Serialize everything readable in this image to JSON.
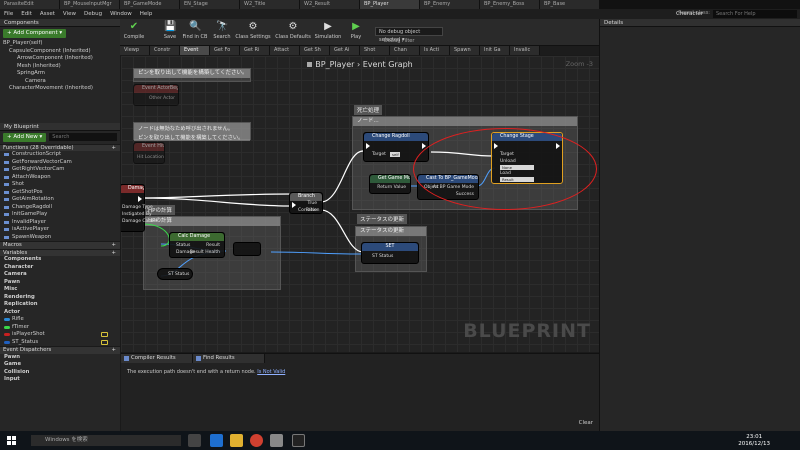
{
  "tabs": [
    "ParasiteEdit",
    "BP_MouseInputMgr",
    "BP_GameMode",
    "EN_Stage",
    "W2_Title",
    "W2_Result",
    "BP_Player",
    "BP_Enemy",
    "BP_Enemy_Boss",
    "BP_Base"
  ],
  "menus": [
    "File",
    "Edit",
    "Asset",
    "View",
    "Debug",
    "Window",
    "Help"
  ],
  "parent_class_label": "Parent class:",
  "parent_class_value": "Character",
  "search_help": "Search For Help",
  "components": {
    "header": "Components",
    "add_label": "+ Add Component ▾",
    "root": "BP_Player(self)",
    "items": [
      "CapsuleComponent (Inherited)",
      "ArrowComponent (Inherited)",
      "Mesh (Inherited)",
      "SpringArm",
      "Camera",
      "CharacterMovement (Inherited)"
    ]
  },
  "my_blueprint": {
    "header": "My Blueprint",
    "add_label": "+ Add New ▾",
    "search_placeholder": "Search",
    "functions_header": "Functions (28 Overridable)",
    "functions": [
      "ConstructionScript",
      "GetForwardVectorCam",
      "GetRightVectorCam",
      "AttachWeapon",
      "Shot",
      "GetShotPos",
      "GetAimRotation",
      "ChangeRagdoll",
      "InitGamePlay",
      "InvalidPlayer",
      "isActivePlayer",
      "SpawnWeapon"
    ],
    "macros_header": "Macros",
    "variables_header": "Variables",
    "var_sections": [
      "Components",
      "Character",
      "Camera",
      "Pawn",
      "Misc",
      "Rendering",
      "Replication",
      "Actor"
    ],
    "variables": [
      {
        "name": "Rifle",
        "color": "#2a8ad8"
      },
      {
        "name": "fTimer",
        "color": "#3ad84a"
      },
      {
        "name": "isPlayerShot",
        "color": "#c82020"
      },
      {
        "name": "ST_Status",
        "color": "#2060c0"
      }
    ],
    "dispatchers_header": "Event Dispatchers",
    "dispatcher_sections": [
      "Pawn",
      "Game",
      "Collision",
      "Input"
    ]
  },
  "toolbar": [
    {
      "label": "Compile",
      "icon": "✔"
    },
    {
      "label": "Save",
      "icon": "💾"
    },
    {
      "label": "Find in CB",
      "icon": "🔍"
    },
    {
      "label": "Search",
      "icon": "🔭"
    },
    {
      "label": "Class Settings",
      "icon": "⚙"
    },
    {
      "label": "Class Defaults",
      "icon": "⚙"
    },
    {
      "label": "Simulation",
      "icon": "▶"
    },
    {
      "label": "Play",
      "icon": "▶"
    }
  ],
  "debug": {
    "selected": "No debug object selected ▾",
    "label": "Debug Filter"
  },
  "graph_tabs": [
    "Viewp",
    "Constr",
    "Event",
    "Get Fo",
    "Get Ri",
    "Attact",
    "Get Sh",
    "Get Ai",
    "Shot",
    "Chan",
    "Is Acti",
    "Spawn",
    "Init Ga",
    "Invalic"
  ],
  "graph": {
    "title": "BP_Player › Event Graph",
    "zoom": "Zoom -3",
    "watermark": "BLUEPRINT",
    "comments": {
      "top": "ピンを取り出して機能を構築してください。",
      "mid_line1": "ノードは無効なため呼び出されません。",
      "mid_line2": "ピンを取り出して機能を構築してください。",
      "death": "死亡処理",
      "death_hint": "ノード...",
      "hp": "HPの計算",
      "hp_sub": "HPの計算",
      "status": "ステータスの更新",
      "status_sub": "ステータスの更新"
    },
    "nodes": {
      "ghost1": "Event ActorBeginOverlap",
      "ghost1_pin": "Other Actor",
      "ghost2": "Event Hit",
      "ghost2_pin": "Hit Location",
      "damage": "Damage",
      "damage_pins": [
        "Damage Type",
        "Instigated By",
        "Damage Causer"
      ],
      "ragdoll": "Change Ragdoll",
      "ragdoll_pin": "Target",
      "ragdoll_field": "self",
      "stage": "Change Stage",
      "stage_pins": [
        "Target",
        "Unload",
        "Load"
      ],
      "stage_fields": [
        "None",
        "Result"
      ],
      "branch": "Branch",
      "branch_pins": [
        "Condition",
        "True",
        "False"
      ],
      "getgm": "Get Game Mode",
      "getgm_pin": "Return Value",
      "cast": "Cast To BP_GameMode",
      "cast_pins": [
        "Object",
        "As BP Game Mode",
        "Success"
      ],
      "setnode": "SET",
      "setnode_pin": "ST Status",
      "calc": "Calc Damage",
      "calc_pins": [
        "Status",
        "Damage",
        "Result",
        "Result Health"
      ],
      "st_status": "ST Status"
    }
  },
  "bottom": {
    "compiler_tab": "Compiler Results",
    "find_tab": "Find Results",
    "message": "The execution path doesn't end with a return node.",
    "message_link": "Is Not Valid",
    "clear": "Clear"
  },
  "details_header": "Details",
  "taskbar": {
    "search": "Windows を検索",
    "time": "23:01",
    "date": "2016/12/13"
  }
}
